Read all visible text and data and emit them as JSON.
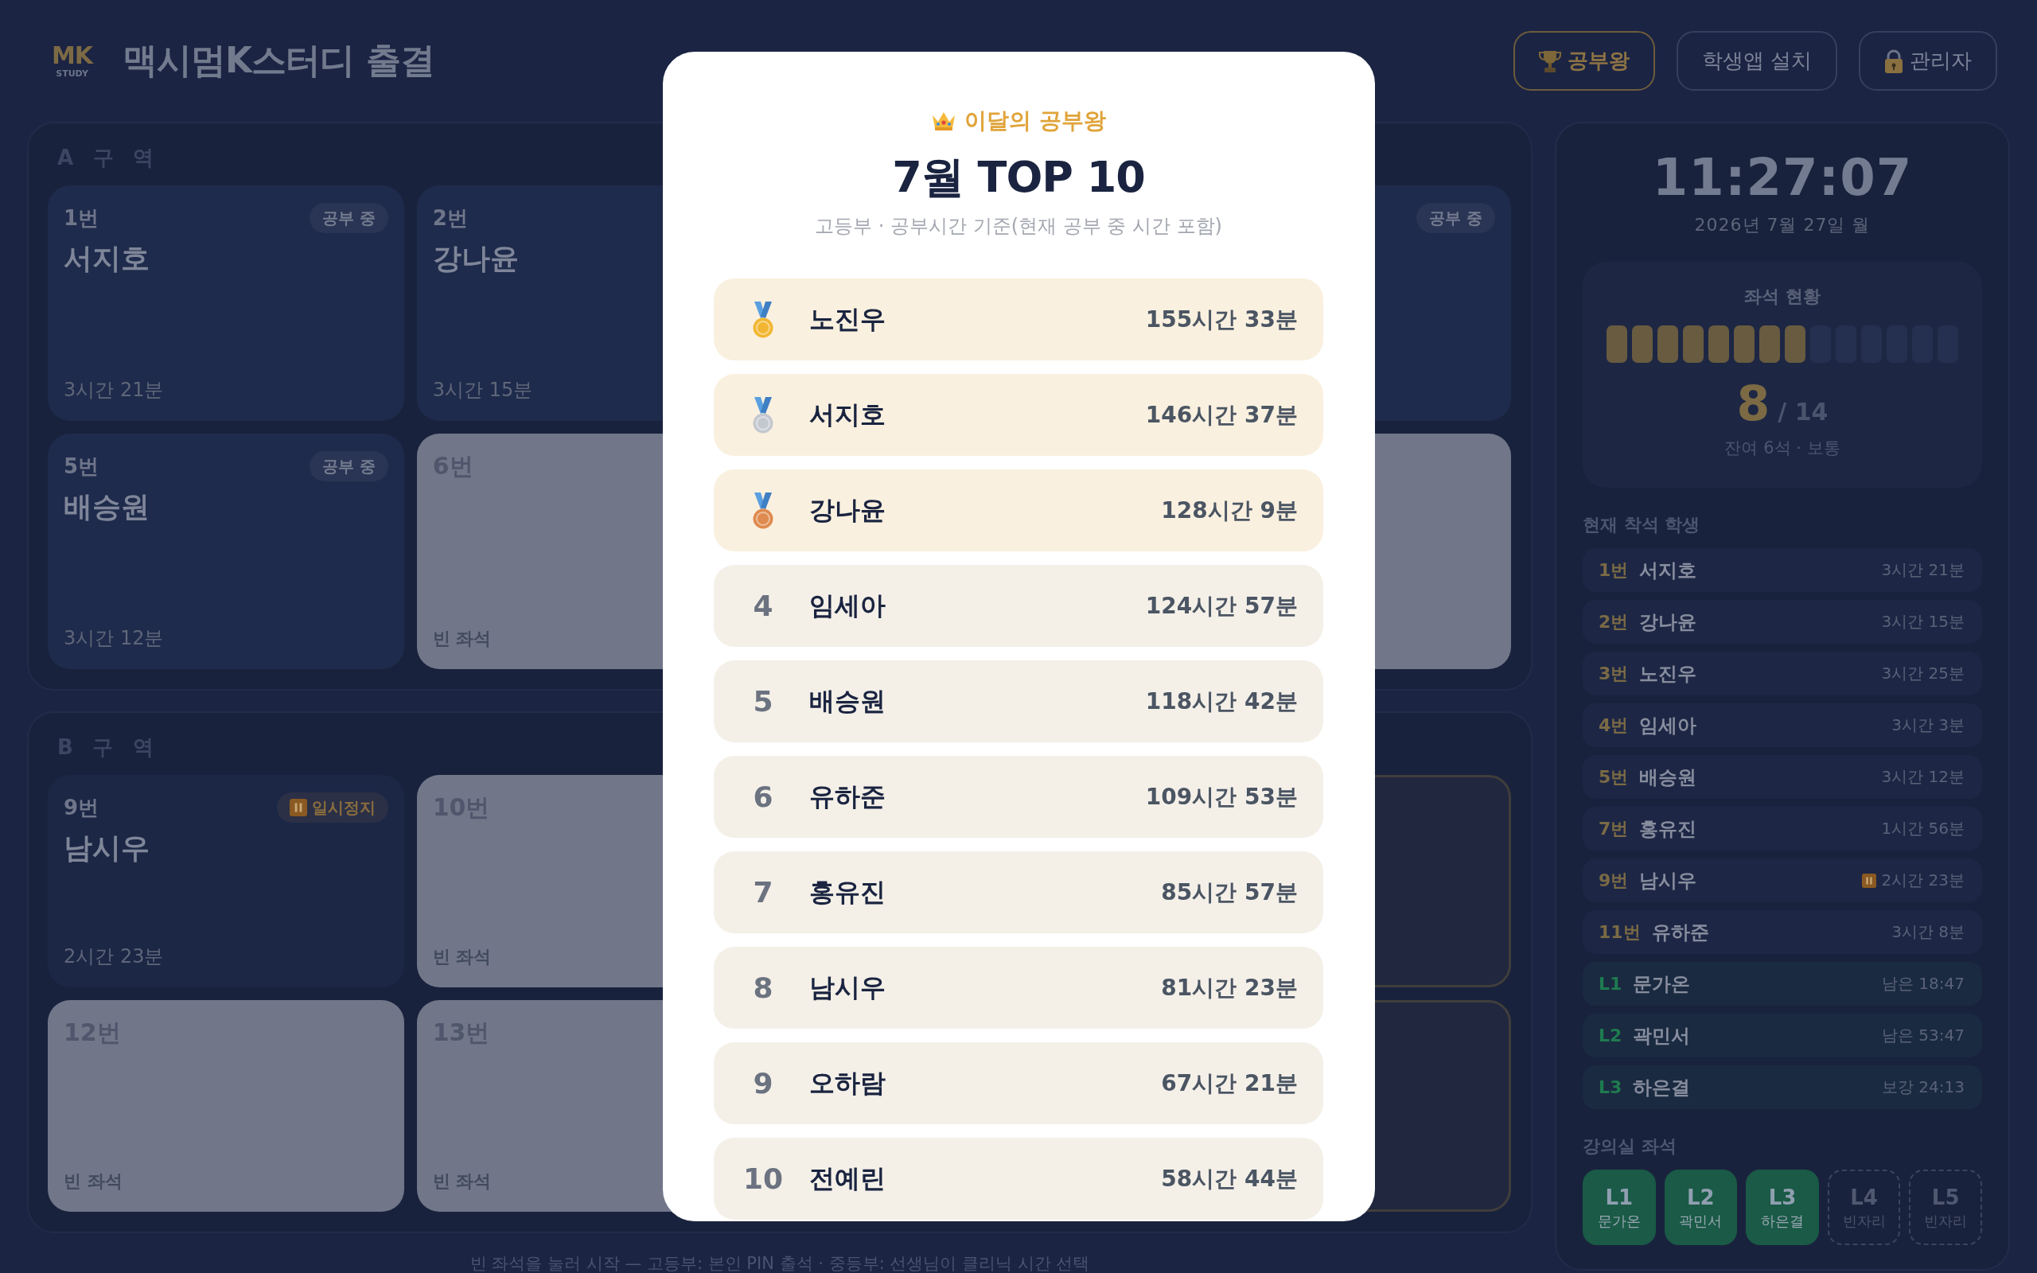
{
  "header": {
    "logo": {
      "mark": "MK",
      "sub": "STUDY"
    },
    "title": "맥시멈K스터디 출결",
    "buttons": [
      {
        "kind": "ranking",
        "label": "공부왕",
        "selected": true
      },
      {
        "kind": "install",
        "label": "학생앱 설치",
        "selected": false
      },
      {
        "kind": "admin",
        "label": "관리자",
        "selected": false
      }
    ]
  },
  "zones": [
    {
      "label": "A 구 역",
      "rows": [
        {
          "left": [
            {
              "kind": "studying",
              "number": "1번",
              "name": "서지호",
              "badge": "공부 중",
              "time": "3시간 21분"
            },
            {
              "kind": "studying",
              "number": "2번",
              "name": "강나윤",
              "time": "3시간 15분"
            }
          ],
          "right": [
            {
              "kind": "studying",
              "badge": "공부 중"
            }
          ]
        },
        {
          "left": [
            {
              "kind": "studying",
              "number": "5번",
              "name": "배승원",
              "badge": "공부 중",
              "time": "3시간 12분"
            },
            {
              "kind": "empty",
              "number": "6번",
              "note": "빈 좌석"
            }
          ],
          "right": [
            {
              "kind": "empty"
            }
          ]
        }
      ]
    },
    {
      "label": "B 구 역",
      "rows": [
        {
          "left": [
            {
              "kind": "paused",
              "number": "9번",
              "name": "남시우",
              "badge": "일시정지",
              "time": "2시간 23분"
            },
            {
              "kind": "empty",
              "number": "10번",
              "note": "빈 좌석"
            }
          ],
          "right": [
            {
              "kind": "outlined"
            }
          ]
        },
        {
          "left": [
            {
              "kind": "empty",
              "number": "12번",
              "note": "빈 좌석"
            },
            {
              "kind": "empty",
              "number": "13번",
              "note": "빈 좌석"
            }
          ],
          "right": [
            {
              "kind": "outlined"
            }
          ]
        }
      ]
    }
  ],
  "hint": "빈 좌석을 눌러 시작 — 고등부: 본인 PIN 출석 · 중등부: 선생님이 클리닉 시간 선택",
  "side_panel": {
    "clock": "11:27:07",
    "date": "2026년 7월 27일 월",
    "seat_status": {
      "title": "좌석 현황",
      "segments": [
        {
          "filled": true
        },
        {
          "filled": true
        },
        {
          "filled": true
        },
        {
          "filled": true
        },
        {
          "filled": true
        },
        {
          "filled": true
        },
        {
          "filled": true
        },
        {
          "filled": true
        },
        {
          "filled": false
        },
        {
          "filled": false
        },
        {
          "filled": false
        },
        {
          "filled": false
        },
        {
          "filled": false
        },
        {
          "filled": false
        }
      ],
      "count": "8",
      "total": "/ 14",
      "note": "잔여 6석 · 보통"
    },
    "current_title": "현재 착석 학생",
    "current": [
      {
        "kind": "seat",
        "number": "1번",
        "name": "서지호",
        "time": "3시간 21분",
        "paused": false
      },
      {
        "kind": "seat",
        "number": "2번",
        "name": "강나윤",
        "time": "3시간 15분",
        "paused": false
      },
      {
        "kind": "seat",
        "number": "3번",
        "name": "노진우",
        "time": "3시간 25분",
        "paused": false
      },
      {
        "kind": "seat",
        "number": "4번",
        "name": "임세아",
        "time": "3시간 3분",
        "paused": false
      },
      {
        "kind": "seat",
        "number": "5번",
        "name": "배승원",
        "time": "3시간 12분",
        "paused": false
      },
      {
        "kind": "seat",
        "number": "7번",
        "name": "홍유진",
        "time": "1시간 56분",
        "paused": false
      },
      {
        "kind": "seat",
        "number": "9번",
        "name": "남시우",
        "time": "2시간 23분",
        "paused": true
      },
      {
        "kind": "seat",
        "number": "11번",
        "name": "유하준",
        "time": "3시간 8분",
        "paused": false
      },
      {
        "kind": "lecture",
        "number": "L1",
        "name": "문가온",
        "time": "남은 18:47",
        "paused": false
      },
      {
        "kind": "lecture",
        "number": "L2",
        "name": "곽민서",
        "time": "남은 53:47",
        "paused": false
      },
      {
        "kind": "lecture",
        "number": "L3",
        "name": "하은결",
        "time": "보강 24:13",
        "paused": false
      }
    ],
    "lecture_title": "강의실 좌석",
    "lecture_seats": [
      {
        "code": "L1",
        "name": "문가온",
        "occupied": true
      },
      {
        "code": "L2",
        "name": "곽민서",
        "occupied": true
      },
      {
        "code": "L3",
        "name": "하은결",
        "occupied": true
      },
      {
        "code": "L4",
        "name": "빈자리",
        "occupied": false
      },
      {
        "code": "L5",
        "name": "빈자리",
        "occupied": false
      }
    ]
  },
  "ranking_modal": {
    "eyebrow": "이달의 공부왕",
    "title": "7월 TOP 10",
    "subtitle": "고등부 · 공부시간 기준(현재 공부 중 시간 포함)",
    "rows": [
      {
        "kind": "medal",
        "color": "#f2b632",
        "name": "노진우",
        "time": "155시간 33분"
      },
      {
        "kind": "medal",
        "color": "#c4c8cf",
        "name": "서지호",
        "time": "146시간 37분"
      },
      {
        "kind": "medal",
        "color": "#df8a4e",
        "name": "강나윤",
        "time": "128시간 9분"
      },
      {
        "kind": "rank",
        "rank": "4",
        "name": "임세아",
        "time": "124시간 57분"
      },
      {
        "kind": "rank",
        "rank": "5",
        "name": "배승원",
        "time": "118시간 42분"
      },
      {
        "kind": "rank",
        "rank": "6",
        "name": "유하준",
        "time": "109시간 53분"
      },
      {
        "kind": "rank",
        "rank": "7",
        "name": "홍유진",
        "time": "85시간 57분"
      },
      {
        "kind": "rank",
        "rank": "8",
        "name": "남시우",
        "time": "81시간 23분"
      },
      {
        "kind": "rank",
        "rank": "9",
        "name": "오하람",
        "time": "67시간 21분"
      },
      {
        "kind": "rank",
        "rank": "10",
        "name": "전예린",
        "time": "58시간 44분"
      }
    ]
  }
}
